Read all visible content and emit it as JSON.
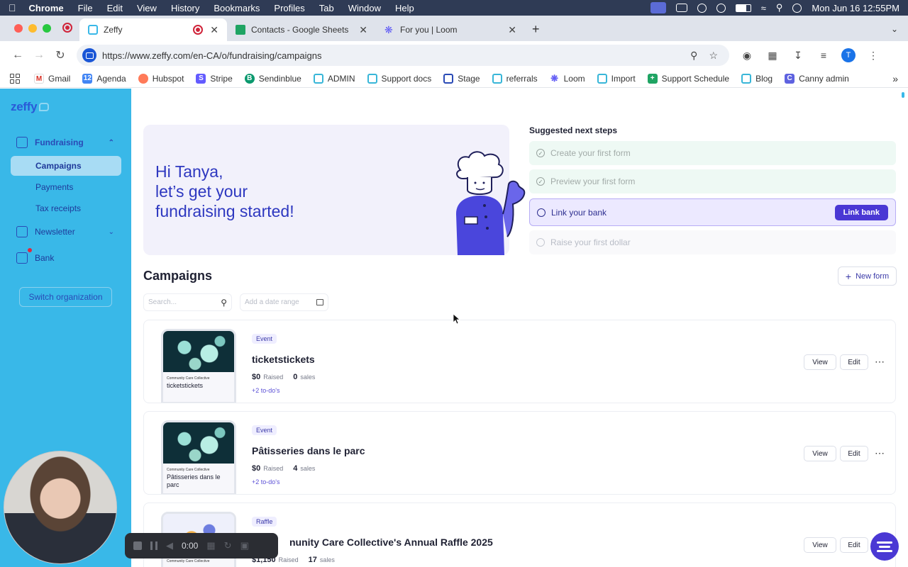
{
  "menubar": {
    "app_name": "Chrome",
    "items": [
      "File",
      "Edit",
      "View",
      "History",
      "Bookmarks",
      "Profiles",
      "Tab",
      "Window",
      "Help"
    ],
    "clock": "Mon Jun 16  12:55PM"
  },
  "tabs": [
    {
      "label": "Zeffy",
      "active": true
    },
    {
      "label": "Contacts - Google Sheets",
      "active": false
    },
    {
      "label": "For you | Loom",
      "active": false
    }
  ],
  "address_bar": {
    "url": "https://www.zeffy.com/en-CA/o/fundraising/campaigns",
    "profile_initial": "T"
  },
  "bookmarks": [
    "Gmail",
    "Agenda",
    "Hubspot",
    "Stripe",
    "Sendinblue",
    "ADMIN",
    "Support docs",
    "Stage",
    "referrals",
    "Loom",
    "Import",
    "Support Schedule",
    "Blog",
    "Canny admin"
  ],
  "sidebar": {
    "logo": "zeffy",
    "fundraising": "Fundraising",
    "sub_items": [
      "Campaigns",
      "Payments",
      "Tax receipts"
    ],
    "newsletter": "Newsletter",
    "bank": "Bank",
    "switch_org": "Switch organization"
  },
  "hero": {
    "line1": "Hi Tanya,",
    "line2": "let’s get your",
    "line3": "fundraising started!"
  },
  "next_steps": {
    "title": "Suggested next steps",
    "steps": [
      {
        "label": "Create your first form",
        "state": "done"
      },
      {
        "label": "Preview your first form",
        "state": "done"
      },
      {
        "label": "Link your bank",
        "state": "current",
        "action": "Link bank"
      },
      {
        "label": "Raise your first dollar",
        "state": "future"
      }
    ]
  },
  "campaigns": {
    "title": "Campaigns",
    "new_form": "New form",
    "search_placeholder": "Search...",
    "date_placeholder": "Add a date range",
    "view_label": "View",
    "edit_label": "Edit",
    "raised_label": "Raised",
    "sales_label": "sales",
    "items": [
      {
        "type": "Event",
        "name": "ticketstickets",
        "raised": "$0",
        "sales": "0",
        "todos": "+2 to-do's",
        "thumb_org": "Community Care Collective",
        "thumb_name": "ticketstickets"
      },
      {
        "type": "Event",
        "name": "Pâtisseries dans le parc",
        "raised": "$0",
        "sales": "4",
        "todos": "+2 to-do's",
        "thumb_org": "Community Care Collective",
        "thumb_name": "Pâtisseries dans le parc"
      },
      {
        "type": "Raffle",
        "name": "nunity Care Collective's Annual Raffle 2025",
        "raised": "$1,150",
        "sales": "17",
        "todos": "",
        "thumb_org": "Community Care Collective",
        "thumb_name": ""
      }
    ]
  },
  "loom": {
    "timer": "0:00"
  },
  "colors": {
    "sidebar": "#39b8e8",
    "brand": "#4a38d4",
    "hero_text": "#2e38c0"
  }
}
